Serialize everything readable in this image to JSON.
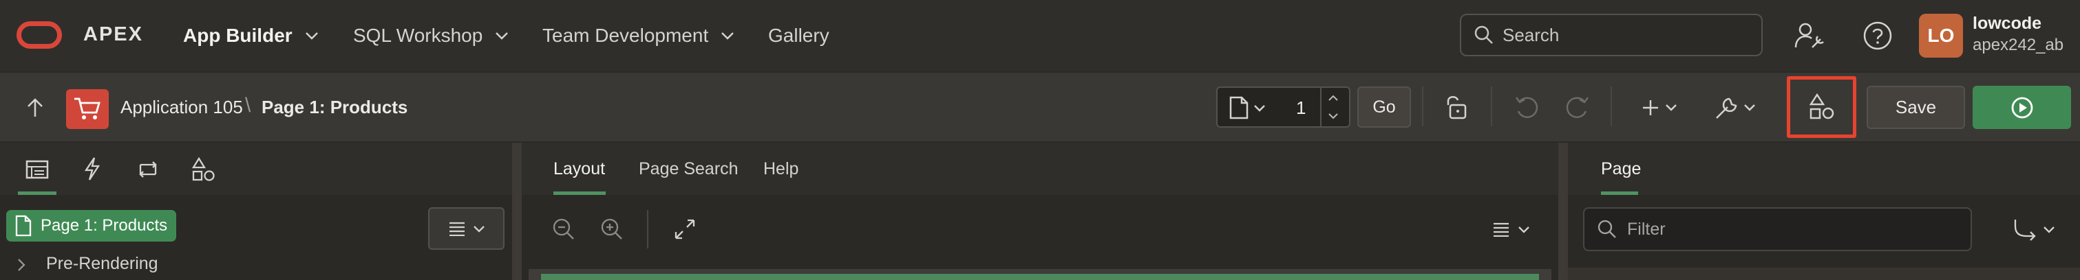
{
  "brand": {
    "name": "APEX"
  },
  "nav": [
    {
      "label": "App Builder",
      "active": true
    },
    {
      "label": "SQL Workshop",
      "active": false
    },
    {
      "label": "Team Development",
      "active": false
    },
    {
      "label": "Gallery",
      "active": false
    }
  ],
  "header": {
    "search_placeholder": "Search",
    "avatar_initials": "LO",
    "user_name": "lowcode",
    "workspace": "apex242_ab"
  },
  "toolbar": {
    "app_crumb": "Application 105",
    "page_crumb": "Page 1: Products",
    "page_number": "1",
    "go_label": "Go",
    "save_label": "Save"
  },
  "left_panel": {
    "tabs": [
      "rendering-icon",
      "dynamic-actions-icon",
      "processing-icon",
      "shared-components-icon"
    ],
    "root_node": "Page 1: Products",
    "first_child": "Pre-Rendering"
  },
  "center_panel": {
    "tabs": [
      {
        "label": "Layout",
        "active": true
      },
      {
        "label": "Page Search",
        "active": false
      },
      {
        "label": "Help",
        "active": false
      }
    ]
  },
  "right_panel": {
    "tab": "Page",
    "filter_placeholder": "Filter"
  },
  "colors": {
    "accent_green": "#3f8a54",
    "brand_red": "#d9473a",
    "highlight_red": "#e8432f"
  }
}
